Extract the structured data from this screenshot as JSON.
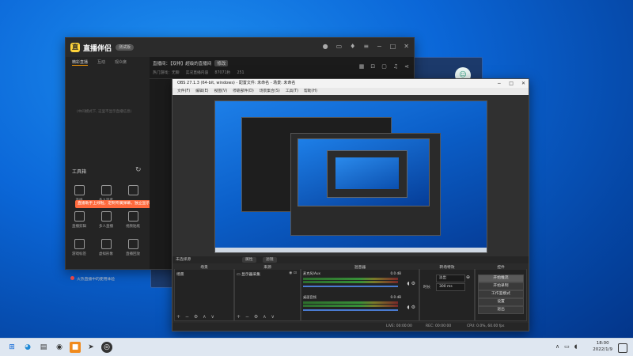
{
  "zhibo": {
    "brand": "直播伴侣",
    "badge": "测试版",
    "left_tabs": [
      "精彩直播",
      "互动",
      "观众席"
    ],
    "empty_text": "(中间模式下, 这里不显示直播信息)",
    "tools_title": "工具箱",
    "tip": "直播助手上线啦，定制专属弹幕，独立显示开播",
    "tools": [
      "连线",
      "多人连麦",
      "",
      "直播剪辑",
      "多人直播",
      "视频贴纸",
      "游戏标签",
      "虚拟形象",
      "直播回放"
    ],
    "bottom_link": "火热直播中的使用体验",
    "room_line": "直播间：【双排】超级的直播间",
    "room_edit": "修改",
    "info": [
      "热门游戏：无聊",
      "实况直播内容",
      "87071秒",
      "251"
    ]
  },
  "obs": {
    "title": "OBS 27.1.3 (64-bit, windows) - 配置文件: 未命名 - 场景: 未命名",
    "menu": [
      "文件(F)",
      "编辑(E)",
      "视图(V)",
      "停靠部件(D)",
      "场景集合(S)",
      "工具(T)",
      "帮助(H)"
    ],
    "selection_label": "未选择源",
    "properties_label": "属性",
    "filters_label": "滤镜",
    "docks": {
      "scenes": "场景",
      "sources": "来源",
      "mixer": "混音器",
      "transitions": "转场特效",
      "controls": "控件"
    },
    "scene_item": "场景",
    "source_item": "显示器采集",
    "mixer_rows": [
      {
        "name": "桌面音频",
        "db": "0.0 dB",
        "level": 0.72
      },
      {
        "name": "麦克风/Aux",
        "db": "0.0 dB",
        "level": 0.68
      }
    ],
    "transition": {
      "type": "淡出",
      "duration_label": "时长",
      "duration": "300 ms"
    },
    "controls": [
      "开始推流",
      "开始录制",
      "工作室模式",
      "设置",
      "退出"
    ],
    "active_control_index": 0,
    "status": {
      "live": "LIVE: 00:00:00",
      "rec": "REC: 00:00:00",
      "cpu": "CPU: 0.0%, 60.00 fps"
    },
    "dock_buttons": "+ − ⚙ ∧ ∨"
  },
  "taskbar": {
    "time": "18:00",
    "date": "2022/1/9"
  },
  "colors": {
    "desktop": "#0b67d8",
    "accent_orange": "#ff6a3d",
    "obs_bg": "#2b2b2b"
  }
}
